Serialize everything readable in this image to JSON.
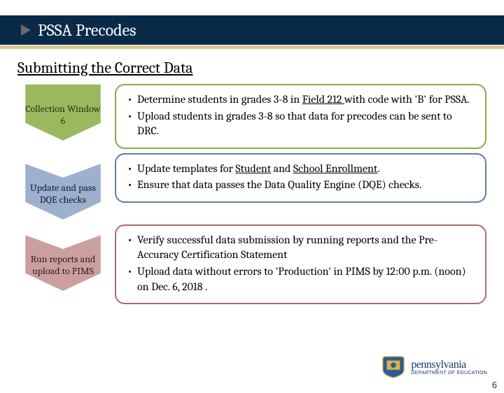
{
  "header": {
    "title": "PSSA Precodes"
  },
  "subheading": "Submitting the Correct Data",
  "steps": [
    {
      "label": "Collection Window 6",
      "bullets": [
        {
          "pre": "Determine students in grades 3-8 in ",
          "u": "Field 212 ",
          "post": "with code with 'B' for PSSA."
        },
        {
          "pre": "Upload students in grades 3-8 so that data for precodes can be sent to DRC.",
          "u": "",
          "post": ""
        }
      ]
    },
    {
      "label": "Update and pass DQE checks",
      "bullets": [
        {
          "pre": "Update templates for ",
          "u": "Student",
          "mid": " and ",
          "u2": "School Enrollment",
          "post": "."
        },
        {
          "pre": "Ensure that data passes the Data Quality Engine (DQE) checks.",
          "u": "",
          "post": ""
        }
      ]
    },
    {
      "label": "Run reports and upload to PIMS",
      "bullets": [
        {
          "pre": "Verify successful data submission by running reports and the Pre-Accuracy Certification Statement",
          "u": "",
          "post": ""
        },
        {
          "pre": "Upload data without errors  to 'Production' in PIMS by 12:00 p.m. (noon) on Dec. 6, 2018 .",
          "u": "",
          "post": ""
        }
      ]
    }
  ],
  "logo": {
    "penn": "pennsylvania",
    "dept": "DEPARTMENT OF EDUCATION"
  },
  "page_number": "6"
}
